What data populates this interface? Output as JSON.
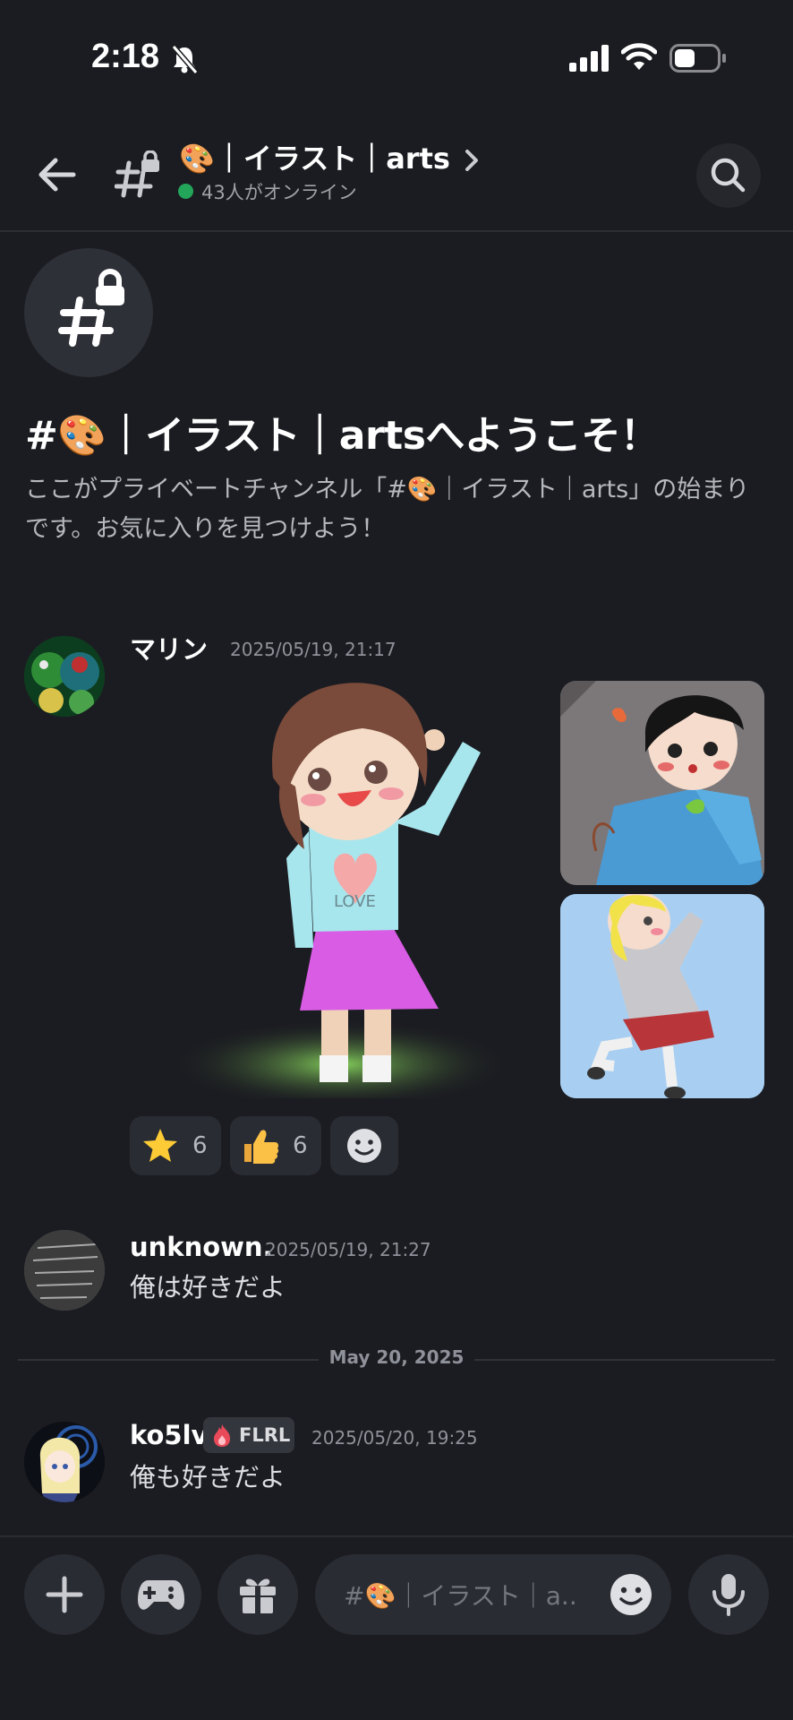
{
  "status_bar": {
    "time": "2:18"
  },
  "header": {
    "channel_name": "🎨｜イラスト｜arts",
    "online_text": "43人がオンライン"
  },
  "intro": {
    "welcome": "#🎨｜イラスト｜artsへようこそ！",
    "description": "ここがプライベートチャンネル「#🎨｜イラスト｜arts」の始まりです。お気に入りを見つけよう！"
  },
  "messages": [
    {
      "username": "マリン",
      "timestamp": "2025/05/19, 21:17",
      "reactions": [
        {
          "emoji": "⭐",
          "count": "6"
        },
        {
          "emoji": "👍",
          "count": "6"
        }
      ]
    },
    {
      "username": "unknown.",
      "timestamp": "2025/05/19, 21:27",
      "text": "俺は好きだよ"
    },
    {
      "username": "ko5lv",
      "badge": "FLRL",
      "timestamp": "2025/05/20, 19:25",
      "text": "俺も好きだよ"
    }
  ],
  "date_divider": "May 20, 2025",
  "composer": {
    "placeholder": "#🎨｜イラスト｜a.."
  },
  "icons": {
    "back": "arrow-left-icon",
    "channel": "locked-hash-icon",
    "search": "search-icon",
    "add": "plus-icon",
    "games": "gamepad-icon",
    "gift": "gift-icon",
    "emoji": "smiley-icon",
    "mic": "microphone-icon"
  },
  "colors": {
    "background": "#1b1c21",
    "online": "#23a55a",
    "reaction_bg": "#2a2c33"
  }
}
